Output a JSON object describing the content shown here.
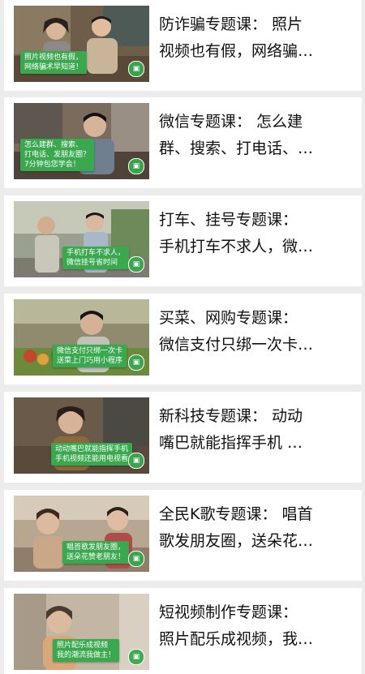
{
  "colors": {
    "background": "#ececec",
    "card": "#ffffff",
    "caption_green": "#39a84e",
    "title_text": "#111111"
  },
  "courses": [
    {
      "title_line1": "防诈骗专题课： 照片",
      "title_line2": "视频也有假，网络骗…",
      "caption_line1": "照片视频也有假，",
      "caption_line2": "网络骗术早知道！",
      "caption_line3": "",
      "thumbnail": "old-couple-at-home",
      "badge_icon": "tv-icon"
    },
    {
      "title_line1": "微信专题课： 怎么建",
      "title_line2": "群、搜索、打电话、…",
      "caption_line1": "怎么建群、搜索、",
      "caption_line2": "打电话、发朋友圈？",
      "caption_line3": "7分钟包您学会！",
      "thumbnail": "man-with-phone-in-kitchen",
      "badge_icon": "tv-icon"
    },
    {
      "title_line1": "打车、挂号专题课：",
      "title_line2": "手机打车不求人，微…",
      "caption_line1": "手机打车不求人，",
      "caption_line2": "微信挂号省时间",
      "caption_line3": "",
      "thumbnail": "two-men-on-street",
      "badge_icon": "tv-icon"
    },
    {
      "title_line1": "买菜、网购专题课：",
      "title_line2": "微信支付只绑一次卡…",
      "caption_line1": "微信支付只绑一次卡",
      "caption_line2": "送菜上门巧用小程序",
      "caption_line3": "",
      "thumbnail": "man-at-market",
      "badge_icon": "tv-icon"
    },
    {
      "title_line1": "新科技专题课： 动动",
      "title_line2": "嘴巴就能指挥手机 …",
      "caption_line1": "动动嘴巴就能指挥手机",
      "caption_line2": "手机视频还能用电视看",
      "caption_line3": "",
      "thumbnail": "woman-in-living-room",
      "badge_icon": "tv-icon"
    },
    {
      "title_line1": "全民K歌专题课： 唱首",
      "title_line2": "歌发朋友圈，送朵花…",
      "caption_line1": "唱首歌发朋友圈，",
      "caption_line2": "送朵花赞老朋友！",
      "caption_line3": "",
      "thumbnail": "two-women-with-phone",
      "badge_icon": "tv-icon"
    },
    {
      "title_line1": "短视频制作专题课：",
      "title_line2": "照片配乐成视频，我…",
      "caption_line1": "照片配乐成视频",
      "caption_line2": "我的潮流我做主！",
      "caption_line3": "",
      "thumbnail": "elderly-woman-smiling",
      "badge_icon": "tv-icon"
    }
  ]
}
